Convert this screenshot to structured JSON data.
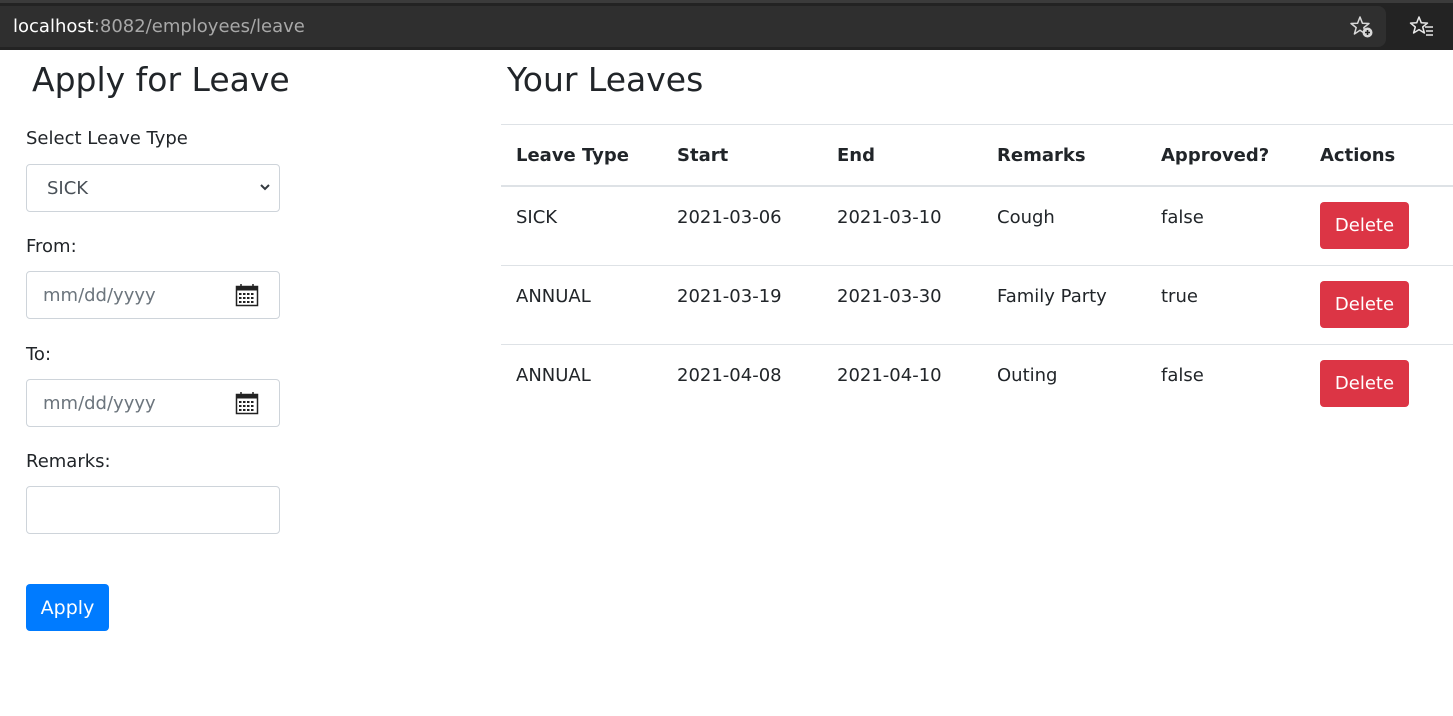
{
  "browser": {
    "url_host": "localhost",
    "url_path": ":8082/employees/leave",
    "icons": [
      "star-add-icon",
      "favorites-icon"
    ]
  },
  "form": {
    "title": "Apply for Leave",
    "leave_type_label": "Select Leave Type",
    "leave_type_value": "SICK",
    "from_label": "From:",
    "from_placeholder": "mm/dd/yyyy",
    "to_label": "To:",
    "to_placeholder": "mm/dd/yyyy",
    "remarks_label": "Remarks:",
    "remarks_value": "",
    "apply_label": "Apply"
  },
  "leaves": {
    "title": "Your Leaves",
    "headers": [
      "Leave Type",
      "Start",
      "End",
      "Remarks",
      "Approved?",
      "Actions"
    ],
    "rows": [
      {
        "type": "SICK",
        "start": "2021-03-06",
        "end": "2021-03-10",
        "remarks": "Cough",
        "approved": "false",
        "action": "Delete"
      },
      {
        "type": "ANNUAL",
        "start": "2021-03-19",
        "end": "2021-03-30",
        "remarks": "Family Party",
        "approved": "true",
        "action": "Delete"
      },
      {
        "type": "ANNUAL",
        "start": "2021-04-08",
        "end": "2021-04-10",
        "remarks": "Outing",
        "approved": "false",
        "action": "Delete"
      }
    ]
  },
  "colors": {
    "primary": "#007bff",
    "danger": "#dc3545",
    "browser_bar": "#232323"
  }
}
